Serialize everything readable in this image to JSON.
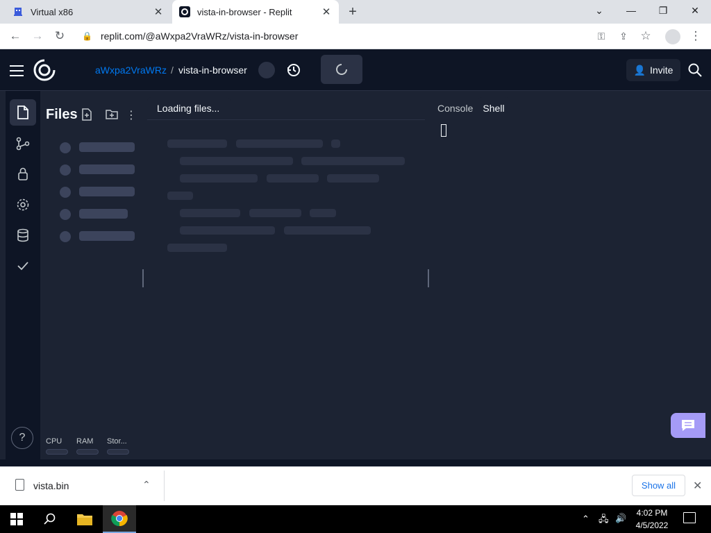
{
  "browser": {
    "tabs": [
      {
        "title": "Virtual x86",
        "active": false
      },
      {
        "title": "vista-in-browser - Replit",
        "active": true
      }
    ],
    "url": "replit.com/@aWxpa2VraWRz/vista-in-browser"
  },
  "replit": {
    "username": "aWxpa2VraWRz",
    "separator": "/",
    "repl_name": "vista-in-browser",
    "invite_label": "Invite",
    "files_title": "Files",
    "resources": [
      "CPU",
      "RAM",
      "Stor..."
    ],
    "editor_tab": "Loading files...",
    "console_tabs": [
      "Console",
      "Shell"
    ],
    "help_label": "?"
  },
  "downloads": {
    "file": "vista.bin",
    "show_all": "Show all"
  },
  "taskbar": {
    "time": "4:02 PM",
    "date": "4/5/2022"
  },
  "colors": {
    "replit_bg": "#0e1525",
    "panel_bg": "#1c2333",
    "accent_blue": "#0079f2",
    "chat_purple": "#a59bf7"
  }
}
